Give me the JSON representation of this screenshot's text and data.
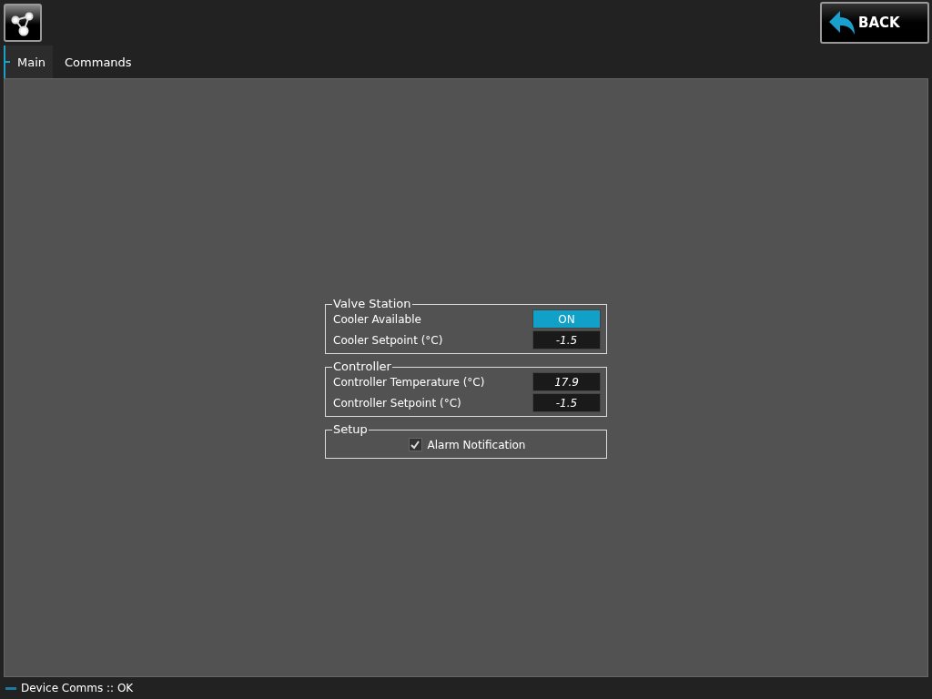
{
  "toolbar": {
    "back_button": "BACK"
  },
  "tabs": [
    {
      "label": "Main",
      "selected": true
    },
    {
      "label": "Commands",
      "selected": false
    }
  ],
  "groups": [
    {
      "title": "Valve Station",
      "rows": [
        {
          "kind": "toggle",
          "label": "Cooler Available",
          "value": "ON",
          "on": true
        },
        {
          "kind": "value",
          "label": "Cooler Setpoint (°C)",
          "value": "-1.5"
        }
      ]
    },
    {
      "title": "Controller",
      "rows": [
        {
          "kind": "value",
          "label": "Controller Temperature (°C)",
          "value": "17.9"
        },
        {
          "kind": "value",
          "label": "Controller Setpoint (°C)",
          "value": "-1.5"
        }
      ]
    },
    {
      "title": "Setup",
      "rows": [
        {
          "kind": "checkbox",
          "label": "Alarm Notification",
          "checked": true
        }
      ]
    }
  ],
  "status_bar": {
    "text": "Device Comms :: OK"
  }
}
